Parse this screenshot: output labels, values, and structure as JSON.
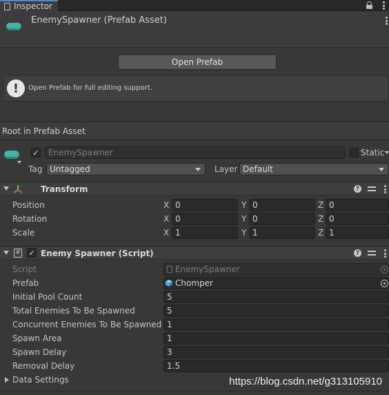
{
  "tab": {
    "label": "Inspector",
    "icon": "inspector-icon"
  },
  "header": {
    "title": "EnemySpawner (Prefab Asset)",
    "icon": "prefab-icon",
    "accent": "#47b3a6"
  },
  "open_prefab": {
    "label": "Open Prefab"
  },
  "help_box": {
    "message": "Open Prefab for full editing support.",
    "icon": "info-exclamation-icon"
  },
  "root_label": "Root in Prefab Asset",
  "gameobject": {
    "active": true,
    "name": "EnemySpawner",
    "static_label": "Static",
    "tag_label": "Tag",
    "tag_value": "Untagged",
    "layer_label": "Layer",
    "layer_value": "Default"
  },
  "transform": {
    "title": "Transform",
    "rows": [
      {
        "label": "Position",
        "x": "0",
        "y": "0",
        "z": "0"
      },
      {
        "label": "Rotation",
        "x": "0",
        "y": "0",
        "z": "0"
      },
      {
        "label": "Scale",
        "x": "1",
        "y": "1",
        "z": "1"
      }
    ],
    "axis_labels": [
      "X",
      "Y",
      "Z"
    ]
  },
  "script_component": {
    "title": "Enemy Spawner (Script)",
    "enabled": true,
    "script_label": "Script",
    "script_value": "EnemySpawner",
    "prefab_label": "Prefab",
    "prefab_value": "Chomper",
    "fields": [
      {
        "label": "Initial Pool Count",
        "value": "5"
      },
      {
        "label": "Total Enemies To Be Spawned",
        "value": "5"
      },
      {
        "label": "Concurrent Enemies To Be Spawned",
        "value": "1"
      },
      {
        "label": "Spawn Area",
        "value": "1"
      },
      {
        "label": "Spawn Delay",
        "value": "3"
      },
      {
        "label": "Removal Delay",
        "value": "1.5"
      }
    ],
    "foldout_label": "Data Settings"
  },
  "watermark": "https://blog.csdn.net/g313105910",
  "help_icon_glyph": "?"
}
